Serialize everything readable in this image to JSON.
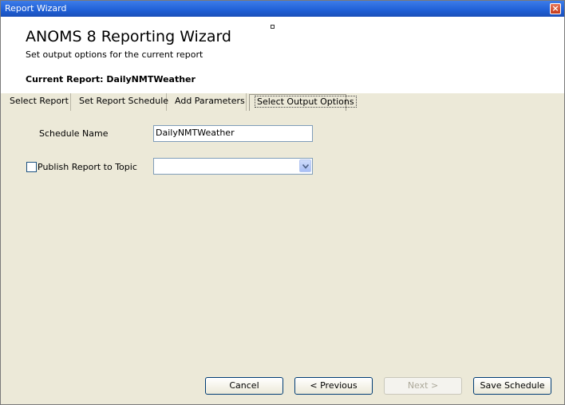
{
  "window": {
    "title": "Report Wizard",
    "close_glyph": "×"
  },
  "header": {
    "title": "ANOMS 8 Reporting Wizard",
    "subtitle": "Set output options for the current report",
    "current_report": "Current Report: DailyNMTWeather"
  },
  "tabs": [
    {
      "label": "Select Report"
    },
    {
      "label": "Set Report Schedule"
    },
    {
      "label": "Add Parameters"
    },
    {
      "label": "Select Output Options",
      "active": true
    }
  ],
  "form": {
    "schedule_name_label": "Schedule Name",
    "schedule_name_value": "DailyNMTWeather",
    "publish_label": "Publish Report to Topic",
    "publish_checked": false,
    "topic_value": ""
  },
  "buttons": {
    "cancel": "Cancel",
    "previous": "< Previous",
    "next": "Next >",
    "save": "Save Schedule"
  },
  "icons": {
    "close": "close-icon",
    "dropdown": "chevron-down-icon"
  }
}
